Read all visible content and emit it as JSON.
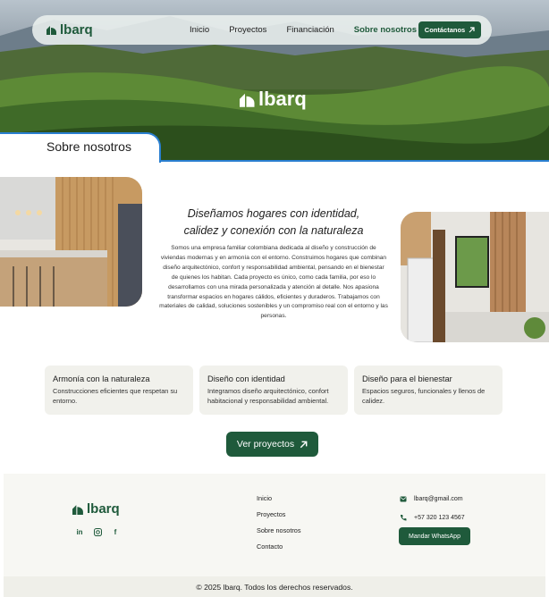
{
  "brand": {
    "name": "lbarq",
    "icon": "house-leaf-logo-icon",
    "color": "#1f5a3b",
    "accent_line": "#2a7fd0"
  },
  "nav": {
    "links": [
      {
        "label": "Inicio",
        "active": false
      },
      {
        "label": "Proyectos",
        "active": false
      },
      {
        "label": "Financiación",
        "active": false
      },
      {
        "label": "Sobre nosotros",
        "active": true
      }
    ],
    "cta_label": "Contáctanos",
    "cta_icon": "arrow-up-right-icon"
  },
  "hero": {
    "section_title": "Sobre nosotros"
  },
  "about": {
    "title": "Diseñamos hogares con identidad, calidez y conexión con la naturaleza",
    "body": "Somos una empresa familiar colombiana dedicada al diseño y construcción de viviendas modernas y en armonía con el entorno. Construimos hogares que combinan diseño arquitectónico, confort y responsabilidad ambiental, pensando en el bienestar de quienes los habitan. Cada proyecto es único, como cada familia, por eso lo desarrollamos con una mirada personalizada y atención al detalle. Nos apasiona transformar espacios en hogares cálidos, eficientes y duraderos. Trabajamos con materiales de calidad, soluciones sostenibles y un compromiso real con el entorno y las personas."
  },
  "features": [
    {
      "title": "Armonía con la naturaleza",
      "desc": "Construcciones eficientes que respetan su entorno."
    },
    {
      "title": "Diseño con identidad",
      "desc": "Integramos diseño arquitectónico, confort habitacional y responsabilidad ambiental."
    },
    {
      "title": "Diseño para el bienestar",
      "desc": "Espacios seguros, funcionales y llenos de calidez."
    }
  ],
  "projects_button": {
    "label": "Ver proyectos",
    "icon": "arrow-up-right-icon"
  },
  "footer": {
    "socials": [
      "linkedin-icon",
      "instagram-icon",
      "facebook-icon"
    ],
    "links": [
      "Inicio",
      "Proyectos",
      "Sobre nosotros",
      "Contacto"
    ],
    "email": "lbarq@gmail.com",
    "phone": "+57 320 123 4567",
    "whatsapp_label": "Mandar WhatsApp",
    "copyright": "© 2025 lbarq. Todos los derechos reservados."
  }
}
